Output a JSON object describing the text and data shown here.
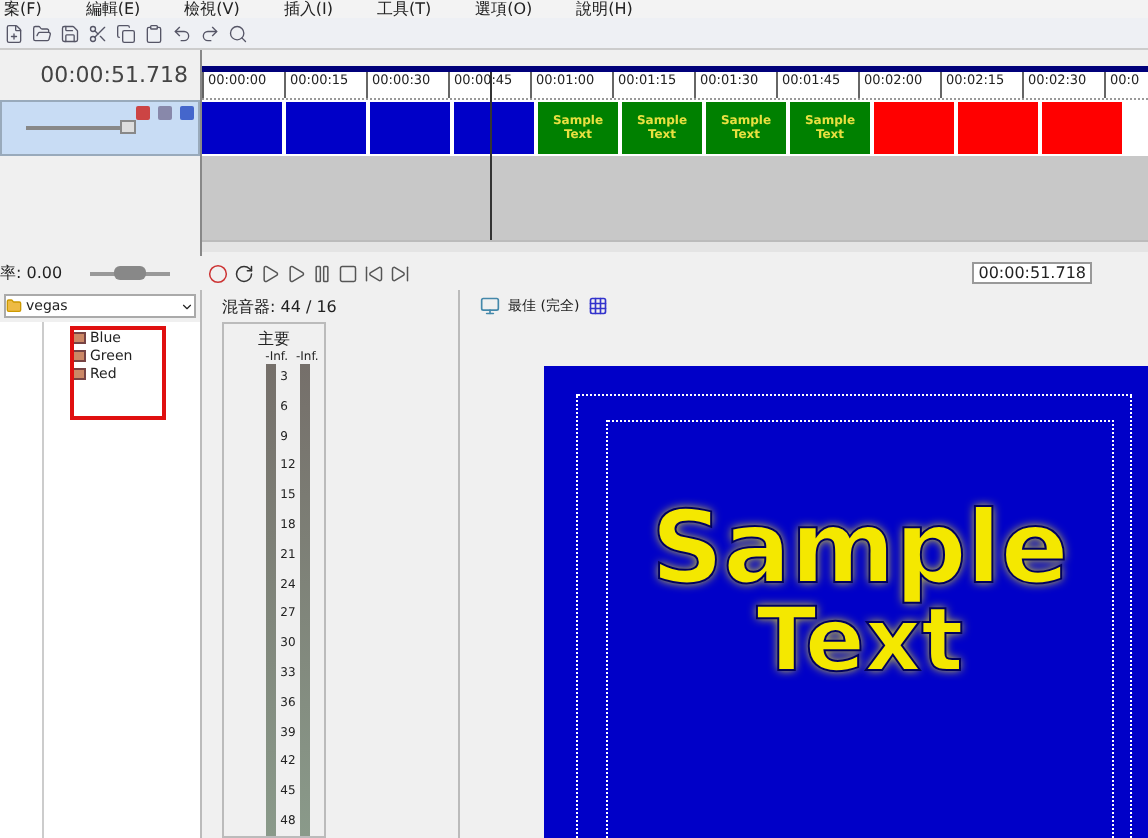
{
  "menu": [
    "案(F)",
    "編輯(E)",
    "檢視(V)",
    "插入(I)",
    "工具(T)",
    "選項(O)",
    "說明(H)"
  ],
  "track_header": {
    "timecode": "00:00:51.718",
    "opacity": {
      "level": 0.95
    }
  },
  "ruler": {
    "ticks": [
      "00:00:00",
      "00:00:15",
      "00:00:30",
      "00:00:45",
      "00:01:00",
      "00:01:15",
      "00:01:30",
      "00:01:45",
      "00:02:00",
      "00:02:15",
      "00:02:30",
      "00:0"
    ]
  },
  "clips": [
    {
      "color": "#0000c8"
    },
    {
      "color": "#0000c8"
    },
    {
      "color": "#0000c8"
    },
    {
      "color": "#0000c8"
    },
    {
      "color": "#008000",
      "label": "Sample Text"
    },
    {
      "color": "#008000",
      "label": "Sample Text"
    },
    {
      "color": "#008000",
      "label": "Sample Text"
    },
    {
      "color": "#008000",
      "label": "Sample Text"
    },
    {
      "color": "#ff0000"
    },
    {
      "color": "#ff0000"
    },
    {
      "color": "#ff0000"
    }
  ],
  "rate": {
    "label": "率: 0.00",
    "level": 0.5
  },
  "transport": {
    "timecode": "00:00:51.718"
  },
  "explorer": {
    "path": "vegas",
    "items": [
      "Blue",
      "Green",
      "Red"
    ]
  },
  "mixer": {
    "title": "混音器: 44 / 16",
    "bus": "主要",
    "peaks": [
      "-Inf.",
      "-Inf."
    ],
    "scale": [
      "3",
      "6",
      "9",
      "12",
      "15",
      "18",
      "21",
      "24",
      "27",
      "30",
      "33",
      "36",
      "39",
      "42",
      "45",
      "48"
    ]
  },
  "preview": {
    "quality": "最佳 (完全)",
    "lines": [
      "Sample",
      "Text"
    ]
  }
}
